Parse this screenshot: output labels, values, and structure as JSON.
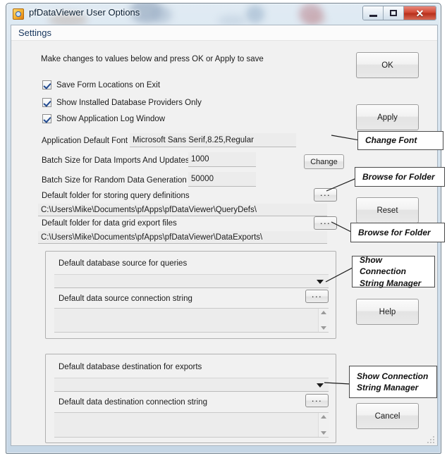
{
  "window": {
    "title": "pfDataViewer User Options",
    "icon": "app-magnifier-icon",
    "controls": {
      "minimize": "minimize-icon",
      "maximize": "maximize-icon",
      "close": "✕"
    }
  },
  "menubar": {
    "items": [
      "Settings"
    ]
  },
  "instruction": "Make changes to values below and press OK or Apply to save",
  "checkboxes": [
    {
      "label": "Save Form Locations on Exit",
      "checked": true
    },
    {
      "label": "Show Installed Database Providers Only",
      "checked": true
    },
    {
      "label": "Show Application Log Window",
      "checked": true
    }
  ],
  "font_row": {
    "label": "Application Default Font",
    "value": "Microsoft Sans Serif,8.25,Regular",
    "button": "Change"
  },
  "batch_rows": [
    {
      "label": "Batch Size for Data Imports And Updates",
      "value": "1000"
    },
    {
      "label": "Batch Size for Random Data Generation",
      "value": "50000"
    }
  ],
  "folder_rows": [
    {
      "label": "Default folder for storing query definitions",
      "value": "C:\\Users\\Mike\\Documents\\pfApps\\pfDataViewer\\QueryDefs\\",
      "browse": "..."
    },
    {
      "label": "Default folder for data grid export files",
      "value": "C:\\Users\\Mike\\Documents\\pfApps\\pfDataViewer\\DataExports\\",
      "browse": "..."
    }
  ],
  "groups": [
    {
      "combo_label": "Default database source for queries",
      "combo_value": "",
      "conn_label": "Default data source connection string",
      "conn_value": "",
      "browse": "..."
    },
    {
      "combo_label": "Default database destination for exports",
      "combo_value": "",
      "conn_label": "Default data destination connection string",
      "conn_value": "",
      "browse": "..."
    }
  ],
  "buttons": {
    "ok": "OK",
    "apply": "Apply",
    "reset": "Reset",
    "help": "Help",
    "cancel": "Cancel"
  },
  "callouts": [
    {
      "lines": [
        "Change Font"
      ]
    },
    {
      "lines": [
        "Browse for Folder"
      ]
    },
    {
      "lines": [
        "Browse for Folder"
      ]
    },
    {
      "lines": [
        "Show Connection",
        "String Manager"
      ]
    },
    {
      "lines": [
        "Show Connection",
        "String Manager"
      ]
    }
  ],
  "colors": {
    "titlebar_glass": "#cfe0ee",
    "close_red": "#c8432c",
    "menu_text": "#17365d",
    "check_blue": "#21498f",
    "form_bg": "#f1f1f1",
    "field_bg": "#ececec"
  }
}
